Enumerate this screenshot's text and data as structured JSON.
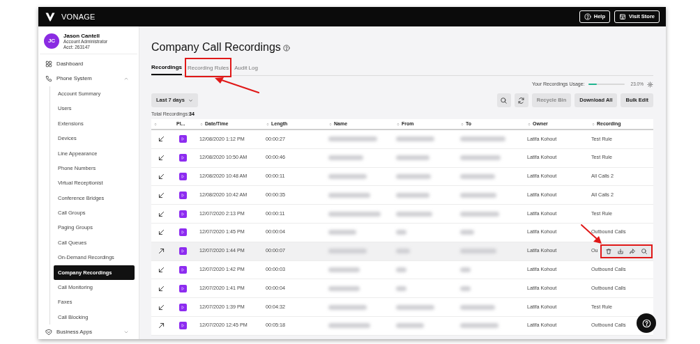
{
  "topbar": {
    "brand": "VONAGE",
    "buttons": [
      {
        "kind": "help",
        "label": "Help"
      },
      {
        "kind": "store",
        "label": "Visit Store"
      }
    ]
  },
  "profile": {
    "initials": "JC",
    "name": "Jason Cantell",
    "role": "Account Administrator",
    "account": "Acct: 263147"
  },
  "sidebar": {
    "items": [
      {
        "label": "Dashboard",
        "selected": false
      },
      {
        "label": "Phone System",
        "expanded": true,
        "selected": false,
        "children": [
          {
            "label": "Account Summary",
            "selected": false
          },
          {
            "label": "Users",
            "selected": false
          },
          {
            "label": "Extensions",
            "selected": false
          },
          {
            "label": "Devices",
            "selected": false
          },
          {
            "label": "Line Appearance",
            "selected": false
          },
          {
            "label": "Phone Numbers",
            "selected": false
          },
          {
            "label": "Virtual Receptionist",
            "selected": false
          },
          {
            "label": "Conference Bridges",
            "selected": false
          },
          {
            "label": "Call Groups",
            "selected": false
          },
          {
            "label": "Paging Groups",
            "selected": false
          },
          {
            "label": "Call Queues",
            "selected": false
          },
          {
            "label": "On-Demand Recordings",
            "selected": false
          },
          {
            "label": "Company Recordings",
            "selected": true
          },
          {
            "label": "Call Monitoring",
            "selected": false
          },
          {
            "label": "Faxes",
            "selected": false
          },
          {
            "label": "Call Blocking",
            "selected": false
          }
        ]
      },
      {
        "label": "Business Apps",
        "expanded": false,
        "selected": false
      }
    ]
  },
  "page": {
    "title": "Company Call Recordings",
    "tabs": [
      {
        "label": "Recordings",
        "selected": true,
        "highlighted": false
      },
      {
        "label": "Recording Rules",
        "selected": false,
        "highlighted": true
      },
      {
        "label": "Audit Log",
        "selected": false,
        "highlighted": false
      }
    ],
    "usage": {
      "label": "Your Recordings Usage:",
      "level": 0.23,
      "reading": "23.0%"
    },
    "filter": {
      "value": "Last 7 days"
    },
    "toolbar": [
      {
        "kind": "search"
      },
      {
        "kind": "refresh"
      },
      {
        "kind": "text",
        "label": "Recycle Bin",
        "disabled": true
      },
      {
        "kind": "text",
        "label": "Download All",
        "disabled": false
      },
      {
        "kind": "text",
        "label": "Bulk Edit",
        "disabled": false
      }
    ],
    "total": {
      "label": "Total Recordings:",
      "value": "34"
    }
  },
  "table": {
    "columns": [
      "",
      "Pl...",
      "Date/Time",
      "Length",
      "Name",
      "From",
      "To",
      "Owner",
      "Recording"
    ],
    "rows": [
      {
        "kind": "incoming",
        "datetime": "12/08/2020 1:12 PM",
        "length": "00:00:27",
        "owner": "Latifa Kohout",
        "recording": "Test Rule",
        "hovered": false
      },
      {
        "kind": "incoming",
        "datetime": "12/08/2020 10:50 AM",
        "length": "00:00:46",
        "owner": "Latifa Kohout",
        "recording": "Test Rule",
        "hovered": false
      },
      {
        "kind": "incoming",
        "datetime": "12/08/2020 10:48 AM",
        "length": "00:00:11",
        "owner": "Latifa Kohout",
        "recording": "All Calls 2",
        "hovered": false
      },
      {
        "kind": "incoming",
        "datetime": "12/08/2020 10:42 AM",
        "length": "00:00:35",
        "owner": "Latifa Kohout",
        "recording": "All Calls 2",
        "hovered": false
      },
      {
        "kind": "incoming",
        "datetime": "12/07/2020 2:13 PM",
        "length": "00:00:11",
        "owner": "Latifa Kohout",
        "recording": "Test Rule",
        "hovered": false
      },
      {
        "kind": "incoming",
        "datetime": "12/07/2020 1:45 PM",
        "length": "00:00:04",
        "owner": "Latifa Kohout",
        "recording": "Outbound Calls",
        "hovered": false
      },
      {
        "kind": "outgoing",
        "datetime": "12/07/2020 1:44 PM",
        "length": "00:00:07",
        "owner": "Latifa Kohout",
        "recording": "Ou",
        "hovered": true,
        "actions_highlighted": true
      },
      {
        "kind": "incoming",
        "datetime": "12/07/2020 1:42 PM",
        "length": "00:00:03",
        "owner": "Latifa Kohout",
        "recording": "Outbound Calls",
        "hovered": false
      },
      {
        "kind": "incoming",
        "datetime": "12/07/2020 1:41 PM",
        "length": "00:00:04",
        "owner": "Latifa Kohout",
        "recording": "Outbound Calls",
        "hovered": false
      },
      {
        "kind": "incoming",
        "datetime": "12/07/2020 1:39 PM",
        "length": "00:04:32",
        "owner": "Latifa Kohout",
        "recording": "Test Rule",
        "hovered": false
      },
      {
        "kind": "outgoing",
        "datetime": "12/07/2020 12:45 PM",
        "length": "00:05:18",
        "owner": "Latifa Kohout",
        "recording": "Outbound Calls",
        "hovered": false
      }
    ]
  },
  "help_fab": {
    "visible": true
  }
}
